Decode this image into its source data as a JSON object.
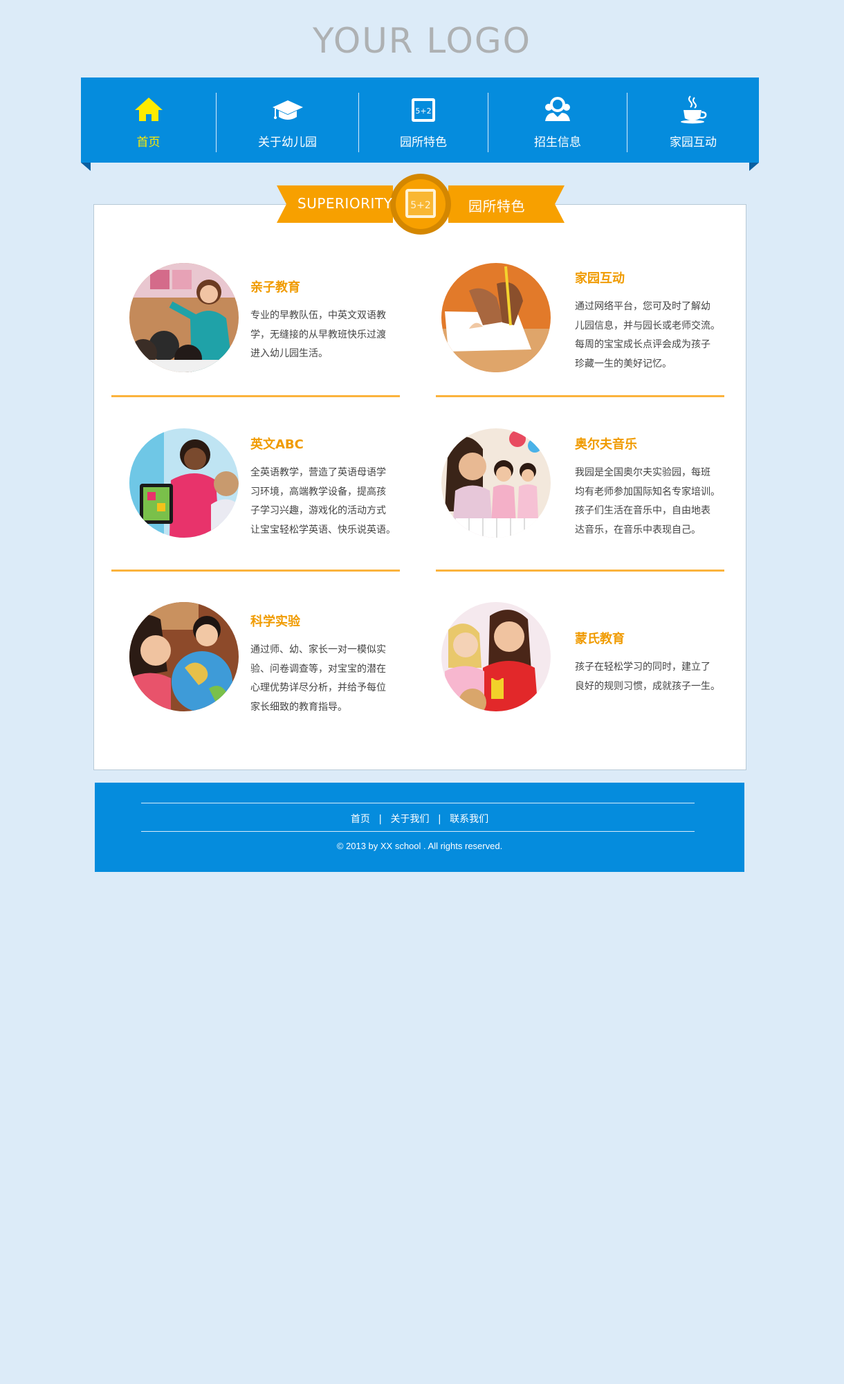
{
  "logo": {
    "text": "YOUR LOGO"
  },
  "nav": {
    "items": [
      {
        "label": "首页",
        "icon": "home-icon",
        "active": true
      },
      {
        "label": "关于幼儿园",
        "icon": "graduation-cap-icon"
      },
      {
        "label": "园所特色",
        "icon": "chalkboard-icon"
      },
      {
        "label": "招生信息",
        "icon": "users-icon"
      },
      {
        "label": "家园互动",
        "icon": "coffee-cup-icon"
      }
    ]
  },
  "section": {
    "title_en": "SUPERIORITY",
    "title_cn": "园所特色",
    "badge_icon": "chalkboard-icon",
    "badge_text": "5+2"
  },
  "features": [
    {
      "title": "亲子教育",
      "lines": [
        "专业的早教队伍，中英文双语教",
        "学，无缝接的从早教班快乐过渡",
        "进入幼儿园生活。"
      ],
      "image": "teacher-with-kids-photo"
    },
    {
      "title": "家园互动",
      "lines": [
        "通过网络平台，您可及时了解幼",
        "儿园信息，并与园长或老师交流。",
        "每周的宝宝成长点评会成为孩子",
        "珍藏一生的美好记忆。"
      ],
      "image": "hands-writing-photo"
    },
    {
      "title": "英文ABC",
      "lines": [
        "全英语教学，营造了英语母语学",
        "习环境，高端教学设备，提高孩",
        "子学习兴趣，游戏化的活动方式",
        "让宝宝轻松学英语、快乐说英语。"
      ],
      "image": "teacher-tablet-photo"
    },
    {
      "title": "奥尔夫音乐",
      "lines": [
        "我园是全国奥尔夫实验园，每班",
        "均有老师参加国际知名专家培训。",
        "孩子们生活在音乐中，自由地表",
        "达音乐，在音乐中表现自己。"
      ],
      "image": "kids-piano-photo"
    },
    {
      "title": "科学实验",
      "lines": [
        "通过师、幼、家长一对一模似实",
        "验、问卷调查等，对宝宝的潜在",
        "心理优势详尽分析，并给予每位",
        "家长细致的教育指导。"
      ],
      "image": "globe-photo"
    },
    {
      "title": "蒙氏教育",
      "lines": [
        "孩子在轻松学习的同时，建立了",
        "良好的规则习惯，成就孩子一生。"
      ],
      "image": "teacher-girls-photo"
    }
  ],
  "footer": {
    "links": [
      "首页",
      "关于我们",
      "联系我们"
    ],
    "separator": "|",
    "copyright": "© 2013 by XX school  . All rights reserved."
  },
  "colors": {
    "background": "#dcebf8",
    "brand_blue": "#058cdd",
    "accent_orange": "#f09b00",
    "ribbon_orange": "#f7a000",
    "nav_active": "#ffeb00"
  }
}
